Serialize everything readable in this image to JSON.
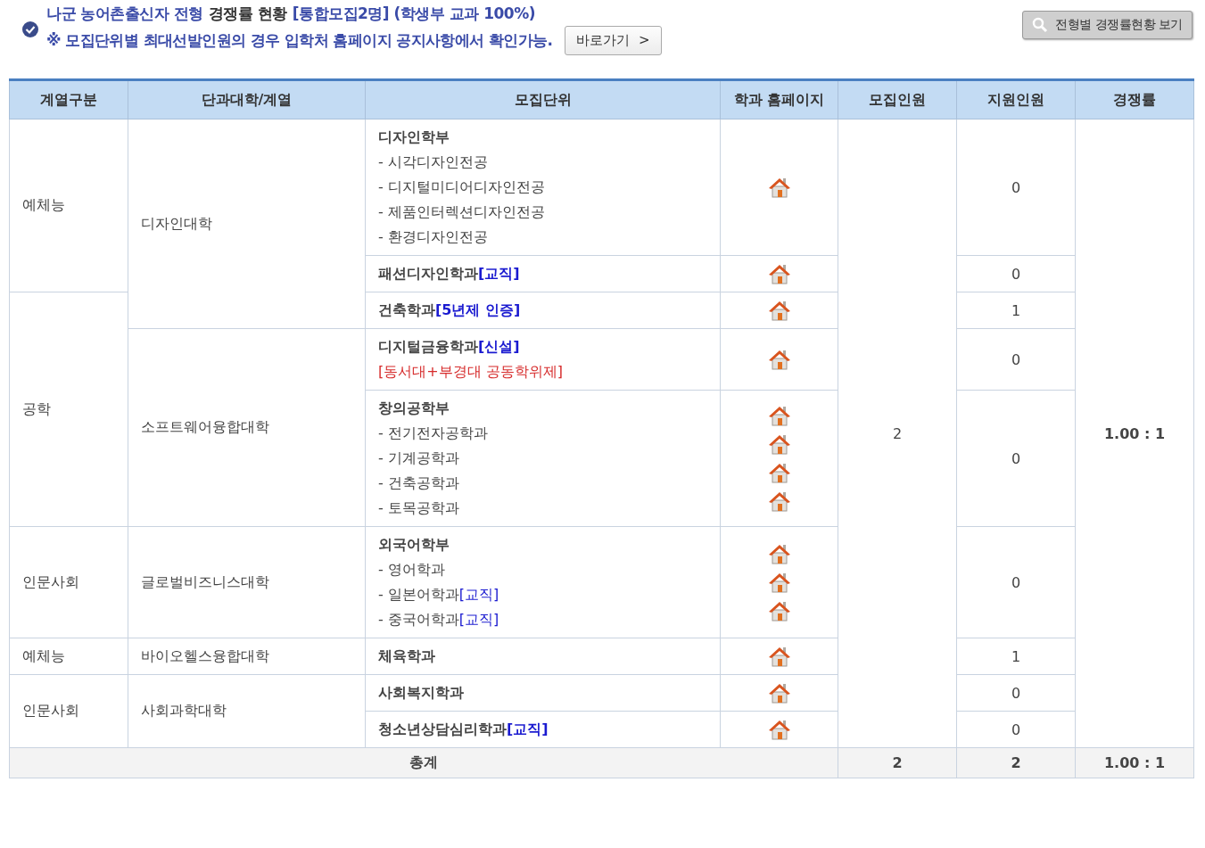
{
  "heading": {
    "parts": [
      {
        "text": "나군 농어촌출신자 전형",
        "kind": "accent"
      },
      {
        "text": "경쟁률 현황",
        "kind": "plain"
      },
      {
        "text": "[통합모집2명] (학생부 교과 100%)",
        "kind": "accent"
      }
    ],
    "notice": "※ 모집단위별 최대선발인원의 경우 입학처 홈페이지 공지사항에서 확인가능.",
    "link_button": "바로가기  >",
    "view_button": "전형별 경쟁률현황 보기"
  },
  "table": {
    "columns": [
      "계열구분",
      "단과대학/계열",
      "모집단위",
      "학과 홈페이지",
      "모집인원",
      "지원인원",
      "경쟁률"
    ],
    "quota": "2",
    "ratio": "1.00 : 1",
    "rows": [
      {
        "category": "예체능",
        "college": "디자인대학",
        "unit": {
          "title": "디자인학부",
          "homepage": true,
          "items": [
            {
              "text": "- 시각디자인전공",
              "homepage": false
            },
            {
              "text": "- 디지털미디어디자인전공",
              "homepage": false
            },
            {
              "text": "- 제품인터렉션디자인전공",
              "homepage": false
            },
            {
              "text": "- 환경디자인전공",
              "homepage": false
            }
          ]
        },
        "applicants": "0"
      },
      {
        "unit": {
          "title": "패션디자인학과",
          "tag": "[교직]",
          "homepage": true
        },
        "applicants": "0"
      },
      {
        "category": "공학",
        "unit": {
          "title": "건축학과",
          "tag": "[5년제 인증]",
          "homepage": true
        },
        "applicants": "1"
      },
      {
        "college": "소프트웨어융합대학",
        "unit": {
          "title": "디지털금융학과",
          "tag": "[신설]",
          "note": "[동서대+부경대 공동학위제]",
          "homepage": true
        },
        "applicants": "0"
      },
      {
        "unit": {
          "title": "창의공학부",
          "homepage": false,
          "items": [
            {
              "text": "- 전기전자공학과",
              "homepage": true
            },
            {
              "text": "- 기계공학과",
              "homepage": true
            },
            {
              "text": "- 건축공학과",
              "homepage": true
            },
            {
              "text": "- 토목공학과",
              "homepage": true
            }
          ]
        },
        "applicants": "0"
      },
      {
        "category": "인문사회",
        "college": "글로벌비즈니스대학",
        "unit": {
          "title": "외국어학부",
          "homepage": false,
          "items": [
            {
              "text": "- 영어학과",
              "homepage": true
            },
            {
              "text": "- 일본어학과",
              "tag": "[교직]",
              "homepage": true
            },
            {
              "text": "- 중국어학과",
              "tag": "[교직]",
              "homepage": true
            }
          ]
        },
        "applicants": "0"
      },
      {
        "category": "예체능",
        "college": "바이오헬스융합대학",
        "unit": {
          "title": "체육학과",
          "homepage": true
        },
        "applicants": "1"
      },
      {
        "category": "인문사회",
        "college": "사회과학대학",
        "unit": {
          "title": "사회복지학과",
          "homepage": true
        },
        "applicants": "0"
      },
      {
        "unit": {
          "title": "청소년상담심리학과",
          "tag": "[교직]",
          "homepage": true
        },
        "applicants": "0"
      }
    ],
    "total": {
      "label": "총계",
      "quota": "2",
      "applicants": "2",
      "ratio": "1.00 : 1"
    }
  }
}
